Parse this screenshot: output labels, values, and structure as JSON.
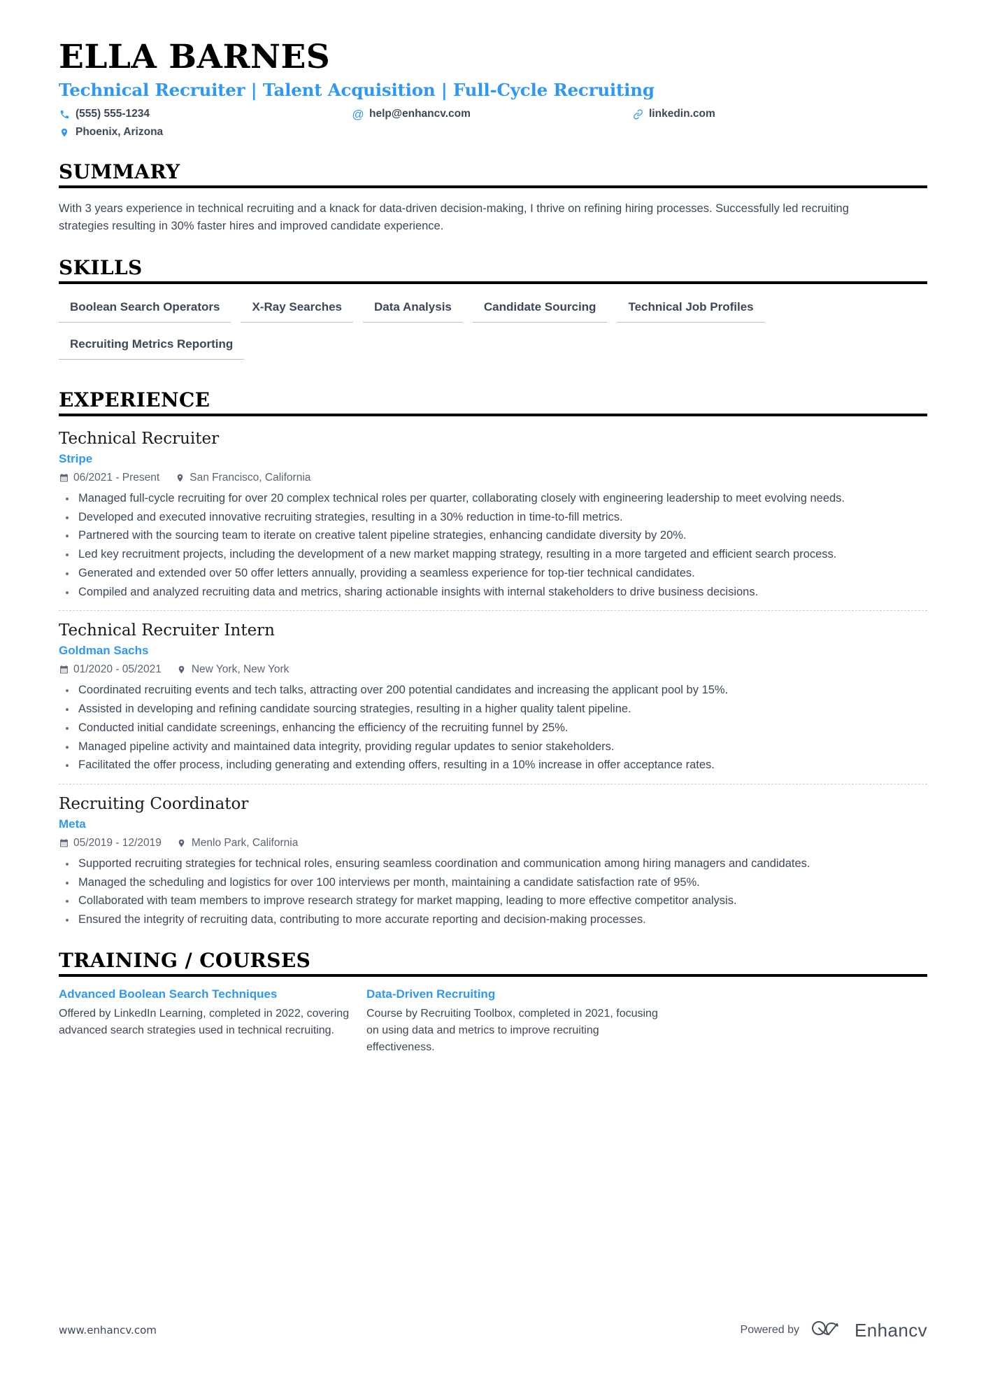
{
  "header": {
    "name": "ELLA BARNES",
    "headline": "Technical Recruiter | Talent Acquisition | Full-Cycle Recruiting",
    "contacts": [
      {
        "icon": "phone-icon",
        "text": "(555) 555-1234"
      },
      {
        "icon": "email-icon",
        "text": "help@enhancv.com"
      },
      {
        "icon": "link-icon",
        "text": "linkedin.com"
      },
      {
        "icon": "location-icon",
        "text": "Phoenix, Arizona"
      }
    ]
  },
  "summary": {
    "heading": "SUMMARY",
    "text": "With 3 years experience in technical recruiting and a knack for data-driven decision-making, I thrive on refining hiring processes. Successfully led recruiting strategies resulting in 30% faster hires and improved candidate experience."
  },
  "skills": {
    "heading": "SKILLS",
    "items": [
      "Boolean Search Operators",
      "X-Ray Searches",
      "Data Analysis",
      "Candidate Sourcing",
      "Technical Job Profiles",
      "Recruiting Metrics Reporting"
    ]
  },
  "experience": {
    "heading": "EXPERIENCE",
    "jobs": [
      {
        "title": "Technical Recruiter",
        "company": "Stripe",
        "dates": "06/2021 - Present",
        "location": "San Francisco, California",
        "bullets": [
          "Managed full-cycle recruiting for over 20 complex technical roles per quarter, collaborating closely with engineering leadership to meet evolving needs.",
          "Developed and executed innovative recruiting strategies, resulting in a 30% reduction in time-to-fill metrics.",
          "Partnered with the sourcing team to iterate on creative talent pipeline strategies, enhancing candidate diversity by 20%.",
          "Led key recruitment projects, including the development of a new market mapping strategy, resulting in a more targeted and efficient search process.",
          "Generated and extended over 50 offer letters annually, providing a seamless experience for top-tier technical candidates.",
          "Compiled and analyzed recruiting data and metrics, sharing actionable insights with internal stakeholders to drive business decisions."
        ]
      },
      {
        "title": "Technical Recruiter Intern",
        "company": "Goldman Sachs",
        "dates": "01/2020 - 05/2021",
        "location": "New York, New York",
        "bullets": [
          "Coordinated recruiting events and tech talks, attracting over 200 potential candidates and increasing the applicant pool by 15%.",
          "Assisted in developing and refining candidate sourcing strategies, resulting in a higher quality talent pipeline.",
          "Conducted initial candidate screenings, enhancing the efficiency of the recruiting funnel by 25%.",
          "Managed pipeline activity and maintained data integrity, providing regular updates to senior stakeholders.",
          "Facilitated the offer process, including generating and extending offers, resulting in a 10% increase in offer acceptance rates."
        ]
      },
      {
        "title": "Recruiting Coordinator",
        "company": "Meta",
        "dates": "05/2019 - 12/2019",
        "location": "Menlo Park, California",
        "bullets": [
          "Supported recruiting strategies for technical roles, ensuring seamless coordination and communication among hiring managers and candidates.",
          "Managed the scheduling and logistics for over 100 interviews per month, maintaining a candidate satisfaction rate of 95%.",
          "Collaborated with team members to improve research strategy for market mapping, leading to more effective competitor analysis.",
          "Ensured the integrity of recruiting data, contributing to more accurate reporting and decision-making processes."
        ]
      }
    ]
  },
  "training": {
    "heading": "TRAINING / COURSES",
    "courses": [
      {
        "title": "Advanced Boolean Search Techniques",
        "description": "Offered by LinkedIn Learning, completed in 2022, covering advanced search strategies used in technical recruiting."
      },
      {
        "title": "Data-Driven Recruiting",
        "description": "Course by Recruiting Toolbox, completed in 2021, focusing on using data and metrics to improve recruiting effectiveness."
      }
    ]
  },
  "footer": {
    "url": "www.enhancv.com",
    "powered_label": "Powered by",
    "brand_name": "Enhancv"
  },
  "colors": {
    "accent": "#2f97f4",
    "text": "#3c4858",
    "rule": "#000000"
  }
}
